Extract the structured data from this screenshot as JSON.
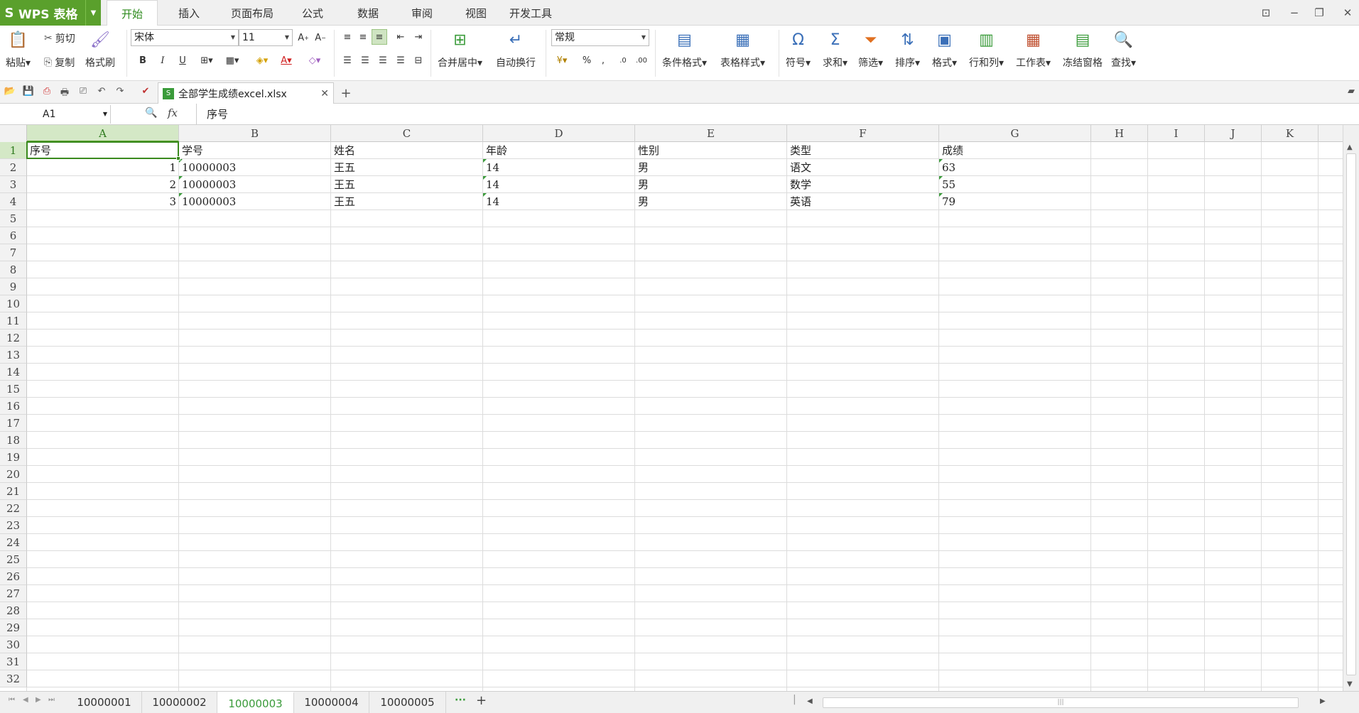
{
  "app": {
    "name": "WPS 表格",
    "logo": "S"
  },
  "ribbon_tabs": [
    "开始",
    "插入",
    "页面布局",
    "公式",
    "数据",
    "审阅",
    "视图",
    "开发工具"
  ],
  "active_ribbon_tab": 0,
  "ribbon": {
    "paste": "粘贴",
    "cut": "剪切",
    "copy": "复制",
    "format_painter": "格式刷",
    "font_name": "宋体",
    "font_size": "11",
    "merge_center": "合并居中",
    "wrap_text": "自动换行",
    "number_format": "常规",
    "percent": "%",
    "comma": ",",
    "cond_format": "条件格式",
    "table_style": "表格样式",
    "symbol": "符号",
    "sum": "求和",
    "filter": "筛选",
    "sort": "排序",
    "format": "格式",
    "row_col": "行和列",
    "worksheet": "工作表",
    "freeze": "冻结窗格",
    "find": "查找",
    "bold": "B",
    "italic": "I",
    "underline": "U"
  },
  "doc_tab": {
    "filename": "全部学生成绩excel.xlsx"
  },
  "formula_bar": {
    "name_box": "A1",
    "fx_label": "fx",
    "content": "序号"
  },
  "columns": [
    "A",
    "B",
    "C",
    "D",
    "E",
    "F",
    "G",
    "H",
    "I",
    "J",
    "K"
  ],
  "row_count": 32,
  "table": {
    "headers": [
      "序号",
      "学号",
      "姓名",
      "年龄",
      "性别",
      "类型",
      "成绩"
    ],
    "rows": [
      [
        "1",
        "10000003",
        "王五",
        "14",
        "男",
        "语文",
        "63"
      ],
      [
        "2",
        "10000003",
        "王五",
        "14",
        "男",
        "数学",
        "55"
      ],
      [
        "3",
        "10000003",
        "王五",
        "14",
        "男",
        "英语",
        "79"
      ]
    ]
  },
  "sheets": [
    "10000001",
    "10000002",
    "10000003",
    "10000004",
    "10000005"
  ],
  "active_sheet": 2,
  "colors": {
    "accent": "#5aa02c",
    "active_text": "#3a9b3a"
  }
}
